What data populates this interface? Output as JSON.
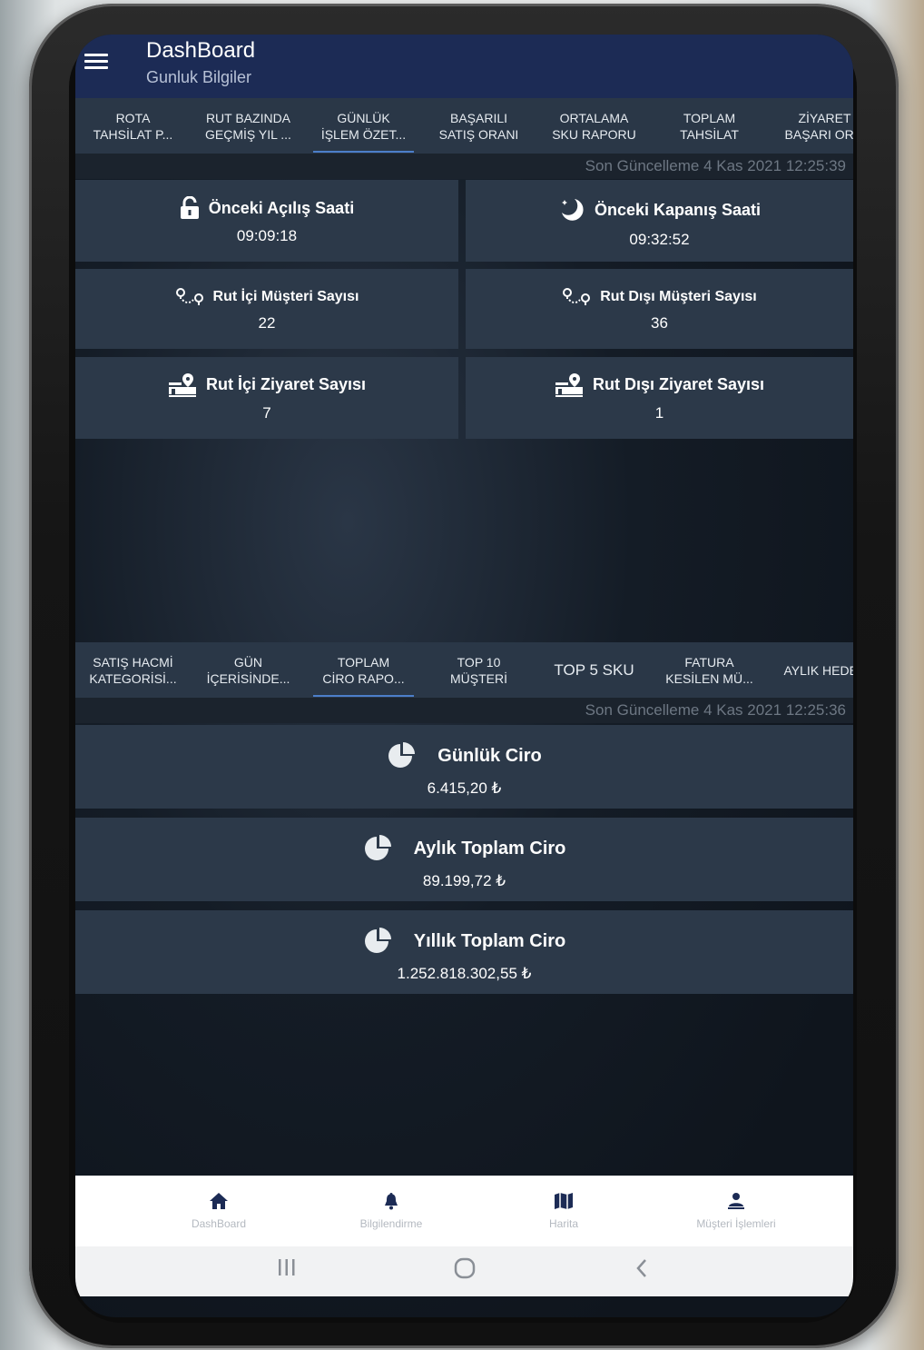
{
  "app": {
    "title": "DashBoard",
    "subtitle": "Gunluk Bilgiler"
  },
  "top_tabs": [
    "ROTA\nTAHSİLAT P...",
    "RUT BAZINDA\nGEÇMİŞ YIL ...",
    "GÜNLÜK\nİŞLEM ÖZET...",
    "BAŞARILI\nSATIŞ ORANI",
    "ORTALAMA\nSKU RAPORU",
    "TOPLAM\nTAHSİLAT",
    "ZİYARET\nBAŞARI OR..."
  ],
  "top_last_update": "Son Güncelleme 4 Kas 2021 12:25:39",
  "stats": {
    "open_label": "Önceki Açılış Saati",
    "open_value": "09:09:18",
    "close_label": "Önceki Kapanış Saati",
    "close_value": "09:32:52",
    "in_route_customers_label": "Rut İçi Müşteri Sayısı",
    "in_route_customers_value": "22",
    "out_route_customers_label": "Rut Dışı Müşteri Sayısı",
    "out_route_customers_value": "36",
    "in_route_visits_label": "Rut İçi Ziyaret Sayısı",
    "in_route_visits_value": "7",
    "out_route_visits_label": "Rut Dışı Ziyaret Sayısı",
    "out_route_visits_value": "1"
  },
  "bottom_tabs": [
    "SATIŞ HACMİ\nKATEGORİSİ...",
    "GÜN\nİÇERİSİNDE...",
    "TOPLAM\nCİRO RAPO...",
    "TOP 10\nMÜŞTERİ",
    "TOP 5 SKU",
    "FATURA\nKESİLEN MÜ...",
    "AYLIK HEDEF"
  ],
  "bottom_last_update": "Son Güncelleme 4 Kas 2021 12:25:36",
  "revenue": {
    "daily_label": "Günlük Ciro",
    "daily_value": "6.415,20 ₺",
    "monthly_label": "Aylık Toplam Ciro",
    "monthly_value": "89.199,72 ₺",
    "yearly_label": "Yıllık Toplam Ciro",
    "yearly_value": "1.252.818.302,55 ₺"
  },
  "bottom_nav": [
    {
      "label": "DashBoard",
      "icon": "home-icon"
    },
    {
      "label": "Bilgilendirme",
      "icon": "bell-icon"
    },
    {
      "label": "Harita",
      "icon": "map-icon"
    },
    {
      "label": "Müşteri İşlemleri",
      "icon": "user-icon"
    }
  ],
  "colors": {
    "appbar": "#1c2b55",
    "card": "#2c3949",
    "tab_bar": "#2a3747",
    "accent": "#4c7ec9"
  }
}
